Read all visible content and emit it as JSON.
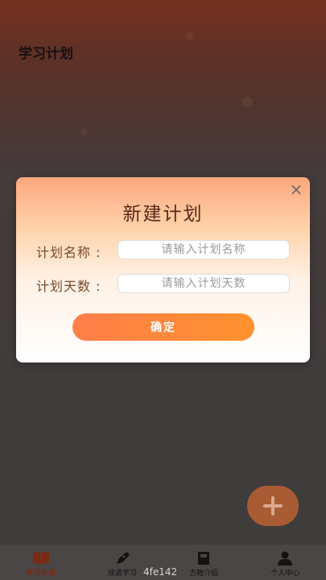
{
  "page": {
    "title": "学习计划"
  },
  "dialog": {
    "title": "新建计划",
    "name_label": "计划名称 :",
    "name_placeholder": "请输入计划名称",
    "days_label": "计划天数 :",
    "days_placeholder": "请输入计划天数",
    "confirm_label": "确定",
    "close_icon": "close-icon"
  },
  "fab": {
    "icon": "plus-icon"
  },
  "tabbar": {
    "tabs": [
      {
        "label": "学习计划",
        "icon": "book-icon",
        "active": true
      },
      {
        "label": "成语学习",
        "icon": "pen-icon",
        "active": false
      },
      {
        "label": "古籍介绍",
        "icon": "book-stack-icon",
        "active": false
      },
      {
        "label": "个人中心",
        "icon": "user-icon",
        "active": false
      }
    ]
  },
  "watermark": "4fe142",
  "colors": {
    "accent": "#ff8a3a",
    "active_tab": "#7a2a14"
  }
}
